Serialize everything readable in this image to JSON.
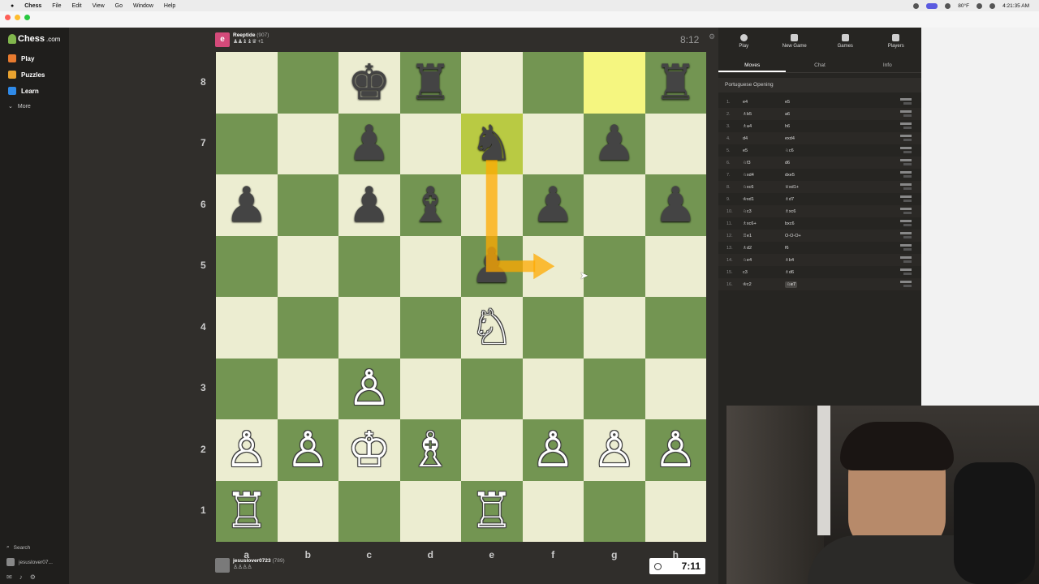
{
  "menubar": {
    "app": "Chess",
    "items": [
      "File",
      "Edit",
      "View",
      "Go",
      "Window",
      "Help"
    ],
    "status": [
      "80°F",
      "4:21:35 AM"
    ]
  },
  "sidebar": {
    "logo": "Chess",
    "logo_suffix": ".com",
    "items": [
      {
        "label": "Play",
        "color": "#e87b2f"
      },
      {
        "label": "Puzzles",
        "color": "#e8a22f"
      },
      {
        "label": "Learn",
        "color": "#2f8ae8"
      }
    ],
    "more": "More",
    "search": "Search",
    "user": "jesuslover07..."
  },
  "top_player": {
    "avatar": "e",
    "name": "Reeptide",
    "rating": "(907)",
    "captures": "♟♟♝♝♛ +1",
    "clock": "8:12"
  },
  "bottom_player": {
    "name": "jesuslover0723",
    "rating": "(789)",
    "captures": "♙♙♙♙",
    "clock": "7:11"
  },
  "board": {
    "ranks": [
      "8",
      "7",
      "6",
      "5",
      "4",
      "3",
      "2",
      "1"
    ],
    "files": [
      "a",
      "b",
      "c",
      "d",
      "e",
      "f",
      "g",
      "h"
    ],
    "highlights": [
      "g8",
      "e7"
    ],
    "pieces": [
      {
        "sq": "c8",
        "p": "♚",
        "c": "b"
      },
      {
        "sq": "d8",
        "p": "♜",
        "c": "b"
      },
      {
        "sq": "h8",
        "p": "♜",
        "c": "b"
      },
      {
        "sq": "c7",
        "p": "♟",
        "c": "b"
      },
      {
        "sq": "e7",
        "p": "♞",
        "c": "b"
      },
      {
        "sq": "g7",
        "p": "♟",
        "c": "b"
      },
      {
        "sq": "a6",
        "p": "♟",
        "c": "b"
      },
      {
        "sq": "c6",
        "p": "♟",
        "c": "b"
      },
      {
        "sq": "d6",
        "p": "♝",
        "c": "b"
      },
      {
        "sq": "f6",
        "p": "♟",
        "c": "b"
      },
      {
        "sq": "h6",
        "p": "♟",
        "c": "b"
      },
      {
        "sq": "e5",
        "p": "♟",
        "c": "b"
      },
      {
        "sq": "e4",
        "p": "♘",
        "c": "w"
      },
      {
        "sq": "c3",
        "p": "♙",
        "c": "w"
      },
      {
        "sq": "a2",
        "p": "♙",
        "c": "w"
      },
      {
        "sq": "b2",
        "p": "♙",
        "c": "w"
      },
      {
        "sq": "c2",
        "p": "♔",
        "c": "w"
      },
      {
        "sq": "d2",
        "p": "♗",
        "c": "w"
      },
      {
        "sq": "f2",
        "p": "♙",
        "c": "w"
      },
      {
        "sq": "g2",
        "p": "♙",
        "c": "w"
      },
      {
        "sq": "h2",
        "p": "♙",
        "c": "w"
      },
      {
        "sq": "a1",
        "p": "♖",
        "c": "w"
      },
      {
        "sq": "e1",
        "p": "♖",
        "c": "w"
      }
    ],
    "arrow": {
      "from": "e7",
      "to": "f5"
    }
  },
  "panel": {
    "tabs": [
      "Play",
      "New Game",
      "Games",
      "Players"
    ],
    "subtabs": [
      "Moves",
      "Chat",
      "Info"
    ],
    "opening": "Portuguese Opening",
    "moves": [
      {
        "n": "1.",
        "w": "e4",
        "b": "e5"
      },
      {
        "n": "2.",
        "w": "♗b5",
        "b": "a6"
      },
      {
        "n": "3.",
        "w": "♗a4",
        "b": "h6"
      },
      {
        "n": "4.",
        "w": "d4",
        "b": "exd4"
      },
      {
        "n": "5.",
        "w": "e5",
        "b": "♘c6"
      },
      {
        "n": "6.",
        "w": "♘f3",
        "b": "d6"
      },
      {
        "n": "7.",
        "w": "♘xd4",
        "b": "dxe5"
      },
      {
        "n": "8.",
        "w": "♘xc6",
        "b": "♕xd1+"
      },
      {
        "n": "9.",
        "w": "♔xd1",
        "b": "♗d7"
      },
      {
        "n": "10.",
        "w": "♘c3",
        "b": "♗xc6"
      },
      {
        "n": "11.",
        "w": "♗xc6+",
        "b": "bxc6"
      },
      {
        "n": "12.",
        "w": "♖e1",
        "b": "O-O-O+"
      },
      {
        "n": "13.",
        "w": "♗d2",
        "b": "f6"
      },
      {
        "n": "14.",
        "w": "♘e4",
        "b": "♗b4"
      },
      {
        "n": "15.",
        "w": "c3",
        "b": "♗d6"
      },
      {
        "n": "16.",
        "w": "♔c2",
        "b": "♘e7"
      }
    ]
  }
}
